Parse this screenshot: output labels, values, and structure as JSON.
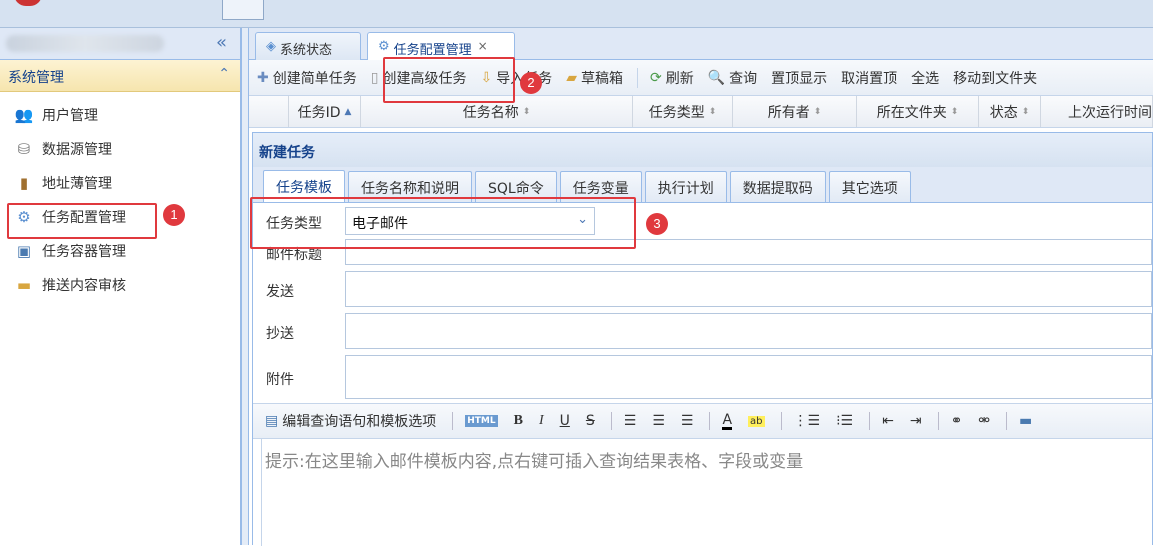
{
  "left_panel": {
    "section_title": "系统管理",
    "items": [
      {
        "label": "用户管理",
        "icon": "users-icon"
      },
      {
        "label": "数据源管理",
        "icon": "database-icon"
      },
      {
        "label": "地址薄管理",
        "icon": "addressbook-icon"
      },
      {
        "label": "任务配置管理",
        "icon": "gear-icon"
      },
      {
        "label": "任务容器管理",
        "icon": "container-icon"
      },
      {
        "label": "推送内容审核",
        "icon": "folder-icon"
      }
    ]
  },
  "tabs": [
    {
      "label": "系统状态",
      "active": false
    },
    {
      "label": "任务配置管理",
      "active": true
    }
  ],
  "toolbar": {
    "create_simple": "创建简单任务",
    "create_advanced": "创建高级任务",
    "import": "导入任务",
    "drafts": "草稿箱",
    "refresh": "刷新",
    "query": "查询",
    "pin_top": "置顶显示",
    "unpin": "取消置顶",
    "select_all": "全选",
    "move_to_folder": "移动到文件夹"
  },
  "grid_columns": [
    "任务ID",
    "任务名称",
    "任务类型",
    "所有者",
    "所在文件夹",
    "状态",
    "上次运行时间"
  ],
  "dialog": {
    "title": "新建任务",
    "subtabs": [
      "任务模板",
      "任务名称和说明",
      "SQL命令",
      "任务变量",
      "执行计划",
      "数据提取码",
      "其它选项"
    ],
    "task_type_label": "任务类型",
    "task_type_value": "电子邮件",
    "mail_subject_label": "邮件标题",
    "send_label": "发送",
    "cc_label": "抄送",
    "attachment_label": "附件",
    "editor_template_button": "编辑查询语句和模板选项",
    "editor_hint": "提示:在这里输入邮件模板内容,点右键可插入查询结果表格、字段或变量"
  },
  "annotations": [
    "1",
    "2",
    "3"
  ],
  "colors": {
    "annotation": "#e0393e",
    "header_blue": "#15428b",
    "panel_border": "#99bbe8"
  }
}
